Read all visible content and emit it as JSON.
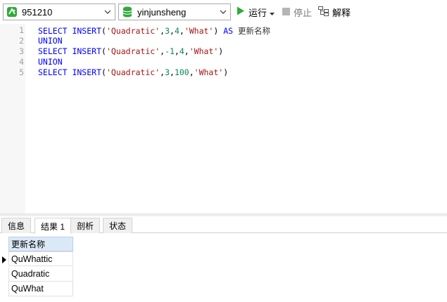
{
  "toolbar": {
    "connection": "951210",
    "database": "yinjunsheng",
    "run_label": "运行",
    "stop_label": "停止",
    "explain_label": "解释"
  },
  "editor": {
    "line_numbers": [
      "1",
      "2",
      "3",
      "4",
      "5"
    ],
    "lines": [
      {
        "kw1": "SELECT INSERT",
        "p1": "(",
        "s1": "'Quadratic'",
        "c1": ",",
        "n1": "3",
        "c2": ",",
        "n2": "4",
        "c3": ",",
        "s2": "'What'",
        "p2": ")",
        "kw2": " AS ",
        "alias": "更新名称"
      },
      {
        "kw1": "UNION"
      },
      {
        "kw1": "SELECT INSERT",
        "p1": "(",
        "s1": "'Quadratic'",
        "c1": ",",
        "n1": "-1",
        "c2": ",",
        "n2": "4",
        "c3": ",",
        "s2": "'What'",
        "p2": ")"
      },
      {
        "kw1": "UNION"
      },
      {
        "kw1": "SELECT INSERT",
        "p1": "(",
        "s1": "'Quadratic'",
        "c1": ",",
        "n1": "3",
        "c2": ",",
        "n2": "100",
        "c3": ",",
        "s2": "'What'",
        "p2": ")"
      }
    ]
  },
  "tabs": [
    {
      "label": "信息"
    },
    {
      "label": "结果 1"
    },
    {
      "label": "剖析"
    },
    {
      "label": "状态"
    }
  ],
  "results": {
    "column": "更新名称",
    "rows": [
      "QuWhattic",
      "Quadratic",
      "QuWhat"
    ]
  },
  "colors": {
    "keyword": "#0000ff",
    "string": "#a31515",
    "number": "#098658",
    "run_green": "#2eaa3a",
    "header_bg": "#dbe9f6"
  }
}
